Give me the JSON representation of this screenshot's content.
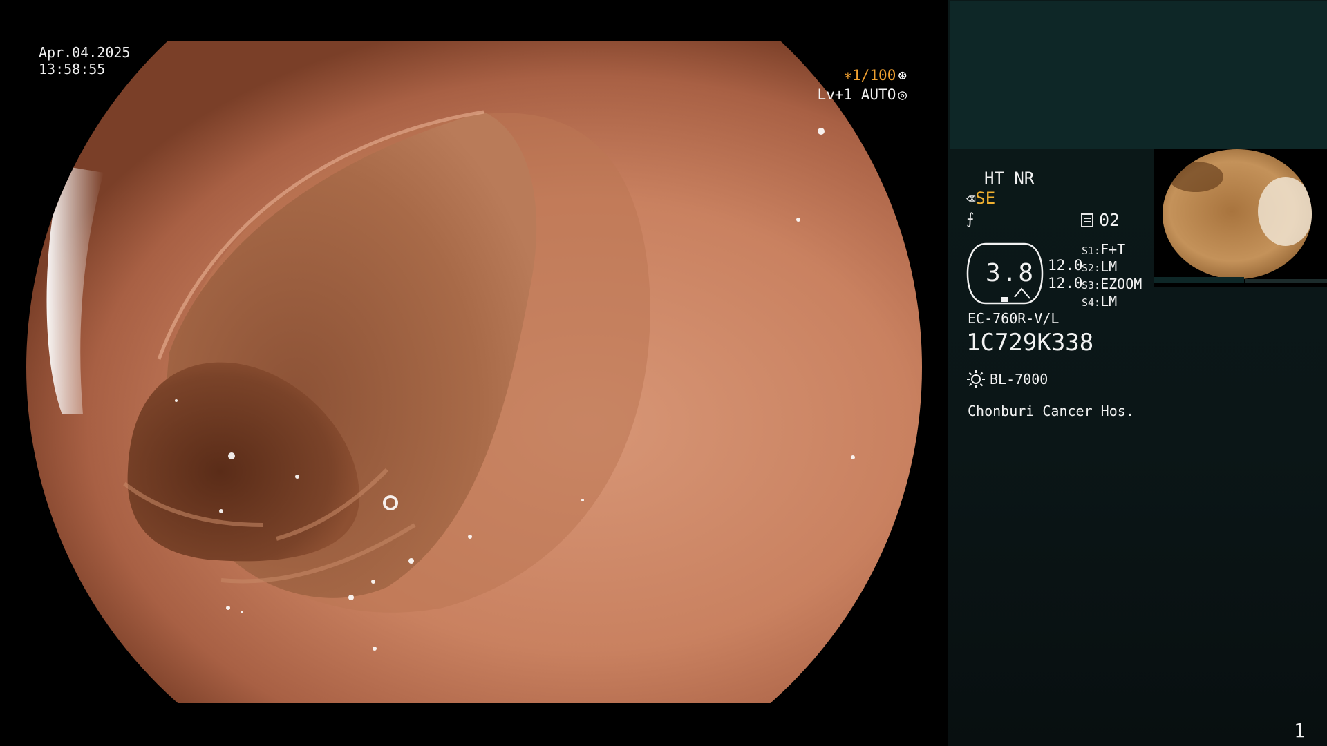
{
  "overlay": {
    "date": "Apr.04.2025",
    "time": "13:58:55",
    "shutter": "∗1/100",
    "shutter_icon": "aperture-icon",
    "level": "Lv+1 AUTO",
    "level_icon": "target-icon"
  },
  "panel": {
    "ht_nr": "HT NR",
    "se_symbol": "⌫",
    "se_label": "SE",
    "structure_symbol": "⨍",
    "mode_icon": "menu-icon",
    "mode_value": "02",
    "zoom_value": "3.8",
    "zoom_a": "12.0",
    "zoom_b": "12.0",
    "switches": [
      {
        "key": "S1:",
        "value": "F+T"
      },
      {
        "key": "S2:",
        "value": "LM"
      },
      {
        "key": "S3:",
        "value": "EZOOM"
      },
      {
        "key": "S4:",
        "value": "LM"
      }
    ],
    "scope_model": "EC-760R-V/L",
    "serial": "1C729K338",
    "light_icon": "sun-icon",
    "light_source": "BL-7000",
    "hospital": "Chonburi Cancer Hos.",
    "page_number": "1"
  },
  "colors": {
    "shutter_text": "#f0a030",
    "se_text": "#f0b030",
    "panel_top": "#0e2727",
    "panel_bg": "#0b1617"
  }
}
